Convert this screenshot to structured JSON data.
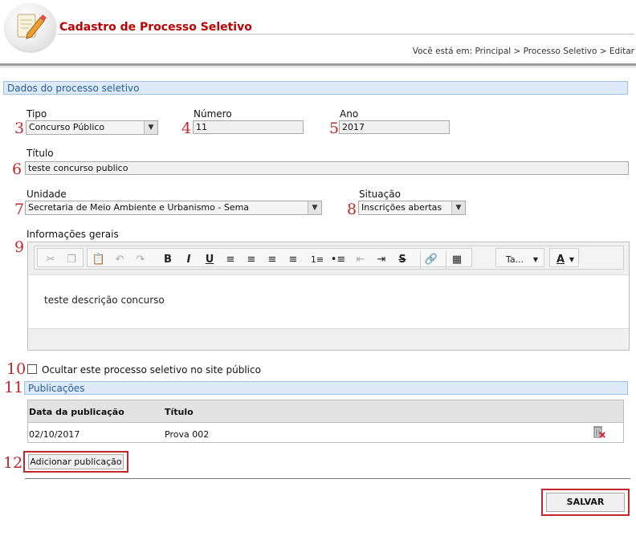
{
  "header": {
    "title": "Cadastro de Processo Seletivo",
    "breadcrumb": "Você está em: Principal > Processo Seletivo > Editar",
    "logo_icon": "edit-pencil-icon"
  },
  "section_main": "Dados do processo seletivo",
  "fields": {
    "tipo": {
      "label": "Tipo",
      "value": "Concurso Público",
      "num": "3"
    },
    "numero": {
      "label": "Número",
      "value": "11",
      "num": "4"
    },
    "ano": {
      "label": "Ano",
      "value": "2017",
      "num": "5"
    },
    "titulo": {
      "label": "Título",
      "value": "teste concurso publico",
      "num": "6"
    },
    "unidade": {
      "label": "Unidade",
      "value": "Secretaria de Meio Ambiente e Urbanismo - Sema",
      "num": "7"
    },
    "situacao": {
      "label": "Situação",
      "value": "Inscrições abertas",
      "num": "8"
    },
    "informacoes": {
      "label": "Informações gerais",
      "num": "9",
      "content": "teste descrição concurso",
      "font_size_label": "Ta...",
      "font_color_label": "A"
    }
  },
  "ocultar": {
    "label": "Ocultar este processo seletivo no site público",
    "num": "10",
    "checked": false
  },
  "publicacoes": {
    "section": "Publicações",
    "num": "11",
    "columns": [
      "Data da publicação",
      "Título"
    ],
    "rows": [
      {
        "data": "02/10/2017",
        "titulo": "Prova 002"
      }
    ],
    "add_button": "Adicionar publicação",
    "add_num": "12"
  },
  "save_button": "SALVAR",
  "colors": {
    "accent_red": "#c0282d",
    "section_blue": "#dce9f7"
  }
}
